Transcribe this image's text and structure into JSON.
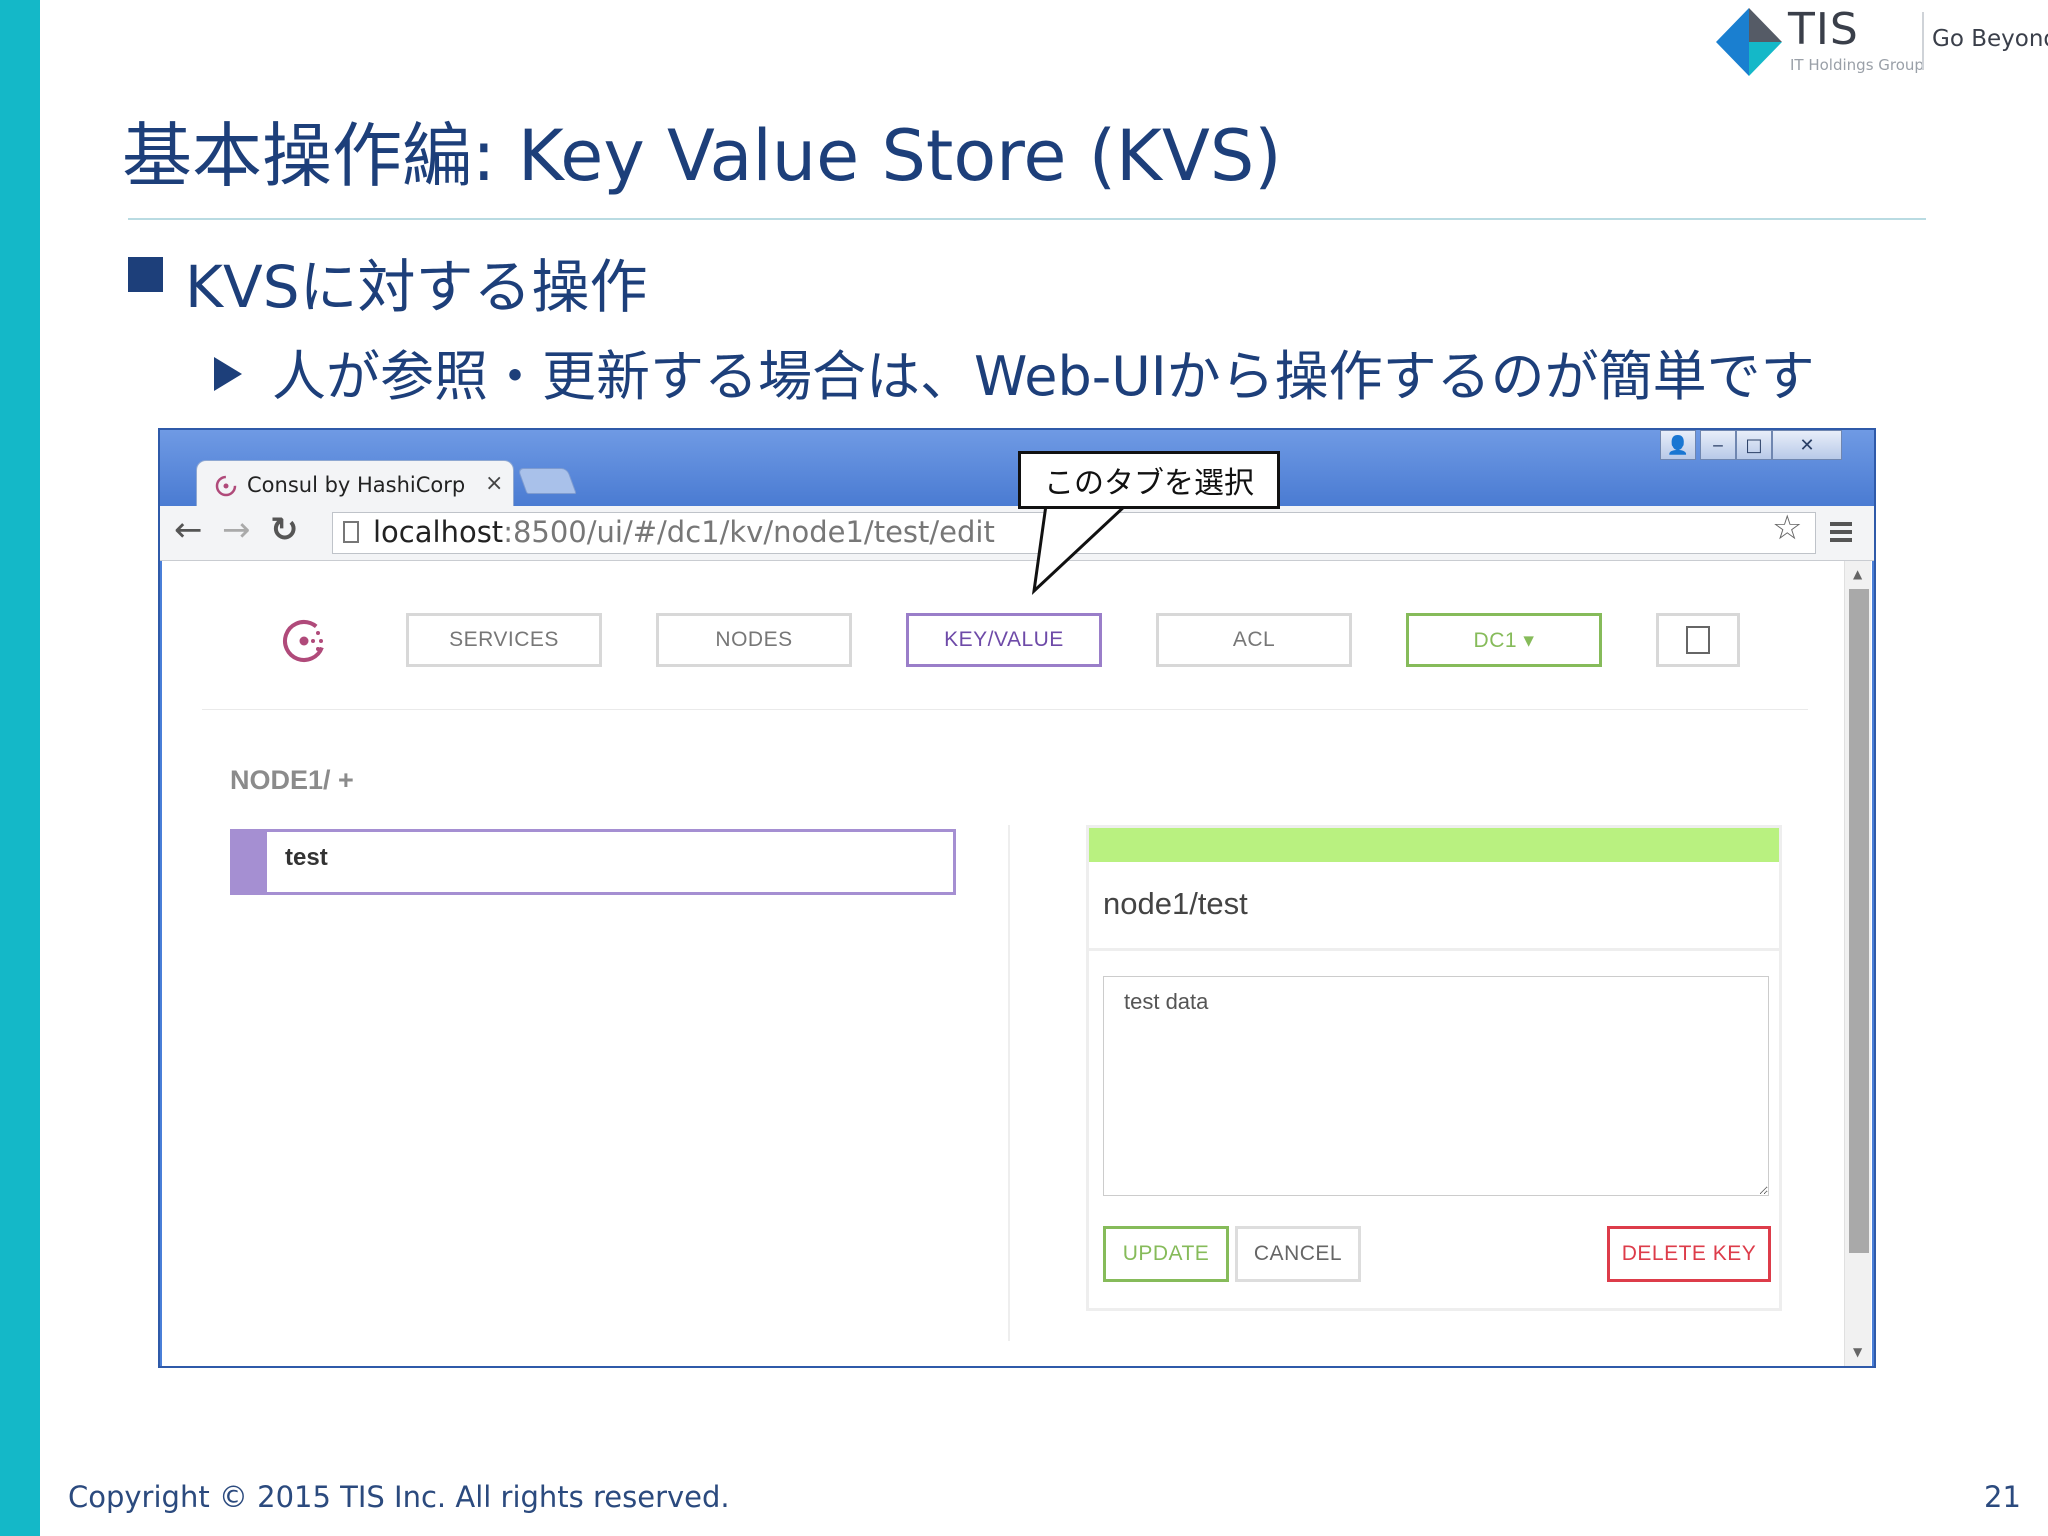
{
  "slide": {
    "title": "基本操作編: Key Value Store (KVS)",
    "bullet_1": "KVSに対する操作",
    "bullet_2": "人が参照・更新する場合は、Web-UIから操作するのが簡単です",
    "copyright": "Copyright © 2015 TIS Inc. All rights reserved.",
    "page_number": "21"
  },
  "logo": {
    "name": "TIS",
    "group": "IT Holdings Group",
    "tagline": "Go Beyond",
    "colors": [
      "#1a7fd0",
      "#14b8c8",
      "#555b66"
    ]
  },
  "callout": {
    "text": "このタブを選択"
  },
  "browser": {
    "tab_title": "Consul by HashiCorp",
    "tab_close": "×",
    "url_host": "localhost",
    "url_rest": ":8500/ui/#/dc1/kv/node1/test/edit",
    "icons": {
      "back": "←",
      "forward": "→",
      "reload": "↻",
      "star": "☆",
      "window_user": "👤",
      "window_minimize": "‒",
      "window_maximize": "□",
      "window_close": "✕"
    }
  },
  "consul": {
    "nav": {
      "services": "SERVICES",
      "nodes": "NODES",
      "key_value": "KEY/VALUE",
      "acl": "ACL",
      "datacenter": "DC1 ▾"
    },
    "breadcrumb": "NODE1/ +",
    "keys": [
      {
        "label": "test"
      }
    ],
    "panel": {
      "title": "node1/test",
      "value": "test data",
      "update_label": "UPDATE",
      "cancel_label": "CANCEL",
      "delete_label": "DELETE KEY"
    },
    "colors": {
      "accent_purple": "#9a7ec9",
      "accent_green": "#86bb5a",
      "panel_header_green": "#b9f180",
      "danger_red": "#dd3c4a"
    }
  }
}
